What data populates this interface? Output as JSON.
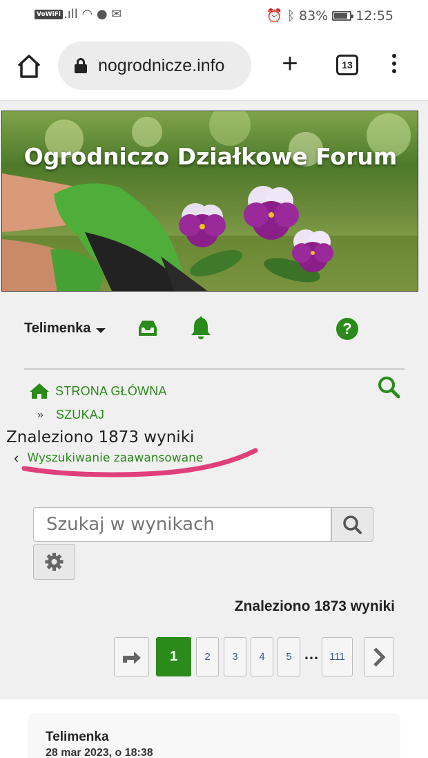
{
  "status_bar": {
    "vowifi": "VoWiFi",
    "battery": "83%",
    "time": "12:55"
  },
  "browser": {
    "url": "nogrodnicze.info",
    "tab_count": "13"
  },
  "banner": {
    "title": "Ogrodniczo Działkowe Forum"
  },
  "toolbar": {
    "username": "Telimenka",
    "help_glyph": "?"
  },
  "breadcrumb": {
    "home": "STRONA GŁÓWNA",
    "separator": "»",
    "search": "SZUKAJ"
  },
  "results": {
    "heading": "Znaleziono 1873 wyniki",
    "advanced_link": "Wyszukiwanie zaawansowane",
    "back_glyph": "‹",
    "search_placeholder": "Szukaj w wynikach",
    "count_label": "Znaleziono 1873 wyniki"
  },
  "pagination": {
    "pages": [
      "1",
      "2",
      "3",
      "4",
      "5"
    ],
    "ellipsis": "…",
    "last": "111",
    "current": "1"
  },
  "post": {
    "author": "Telimenka",
    "date": "28 mar 2023, o 18:38"
  },
  "colors": {
    "accent": "#2a8a1a",
    "annotation": "#e0407a"
  }
}
